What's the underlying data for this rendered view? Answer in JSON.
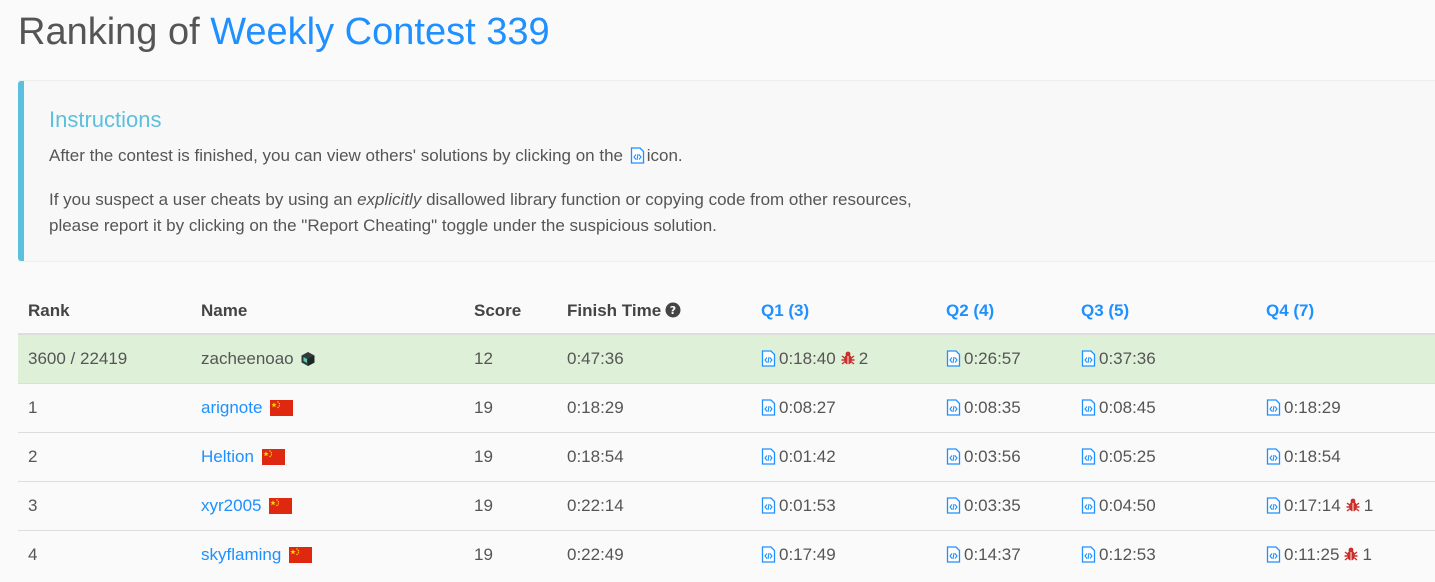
{
  "header": {
    "title_prefix": "Ranking of",
    "contest_name": "Weekly Contest 339"
  },
  "instructions": {
    "heading": "Instructions",
    "p1_before": "After the contest is finished, you can view others' solutions by clicking on the",
    "p1_after": "icon.",
    "p2_part1": "If you suspect a user cheats by using an",
    "p2_emphasis": "explicitly",
    "p2_part2": "disallowed library function or copying code from other resources,",
    "p2_part3": "please report it by clicking on the \"Report Cheating\" toggle under the suspicious solution."
  },
  "table": {
    "headers": {
      "rank": "Rank",
      "name": "Name",
      "score": "Score",
      "finish_time": "Finish Time",
      "q1": "Q1 (3)",
      "q2": "Q2 (4)",
      "q3": "Q3 (5)",
      "q4": "Q4 (7)"
    },
    "rows": [
      {
        "rank": "3600 / 22419",
        "name": "zacheenoao",
        "score": "12",
        "finish": "0:47:36",
        "q1": "0:18:40",
        "q1_bugs": "2",
        "q2": "0:26:57",
        "q3": "0:37:36",
        "q4": ""
      },
      {
        "rank": "1",
        "name": "arignote",
        "score": "19",
        "finish": "0:18:29",
        "q1": "0:08:27",
        "q2": "0:08:35",
        "q3": "0:08:45",
        "q4": "0:18:29"
      },
      {
        "rank": "2",
        "name": "Heltion",
        "score": "19",
        "finish": "0:18:54",
        "q1": "0:01:42",
        "q2": "0:03:56",
        "q3": "0:05:25",
        "q4": "0:18:54"
      },
      {
        "rank": "3",
        "name": "xyr2005",
        "score": "19",
        "finish": "0:22:14",
        "q1": "0:01:53",
        "q2": "0:03:35",
        "q3": "0:04:50",
        "q4": "0:17:14",
        "q4_bugs": "1"
      },
      {
        "rank": "4",
        "name": "skyflaming",
        "score": "19",
        "finish": "0:22:49",
        "q1": "0:17:49",
        "q2": "0:14:37",
        "q3": "0:12:53",
        "q4": "0:11:25",
        "q4_bugs": "1"
      }
    ]
  },
  "colors": {
    "accent": "#1e90ff",
    "callout": "#5bc0de",
    "highlight_row": "#dff0d8",
    "bug": "#c9302c",
    "flag_red": "#de2910",
    "flag_star": "#ffde00"
  }
}
